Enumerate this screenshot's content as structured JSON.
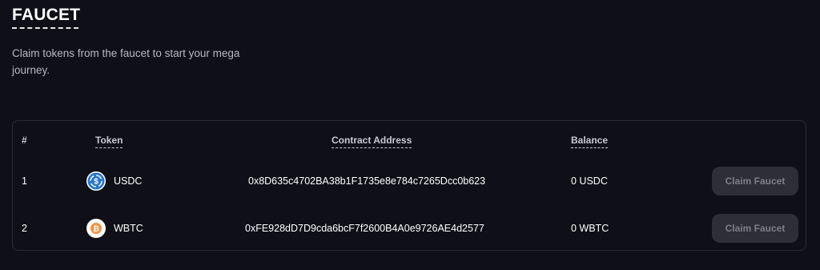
{
  "header": {
    "title": "FAUCET",
    "subtitle": "Claim tokens from the faucet to start your mega journey."
  },
  "table": {
    "columns": {
      "index": "#",
      "token": "Token",
      "contract": "Contract Address",
      "balance": "Balance"
    },
    "rows": [
      {
        "index": "1",
        "token": "USDC",
        "icon": "usdc-icon",
        "icon_color": "#2775ca",
        "contract": "0x8D635c4702BA38b1F1735e8e784c7265Dcc0b623",
        "balance": "0 USDC",
        "action": "Claim Faucet"
      },
      {
        "index": "2",
        "token": "WBTC",
        "icon": "wbtc-icon",
        "icon_color": "#f09242",
        "contract": "0xFE928dD7D9cda6bcF7f2600B4A0e9726AE4d2577",
        "balance": "0 WBTC",
        "action": "Claim Faucet"
      }
    ]
  },
  "colors": {
    "background": "#0f1017",
    "border": "#2a2c35",
    "button_bg": "#2e2f36",
    "button_text": "#7e7f86"
  }
}
